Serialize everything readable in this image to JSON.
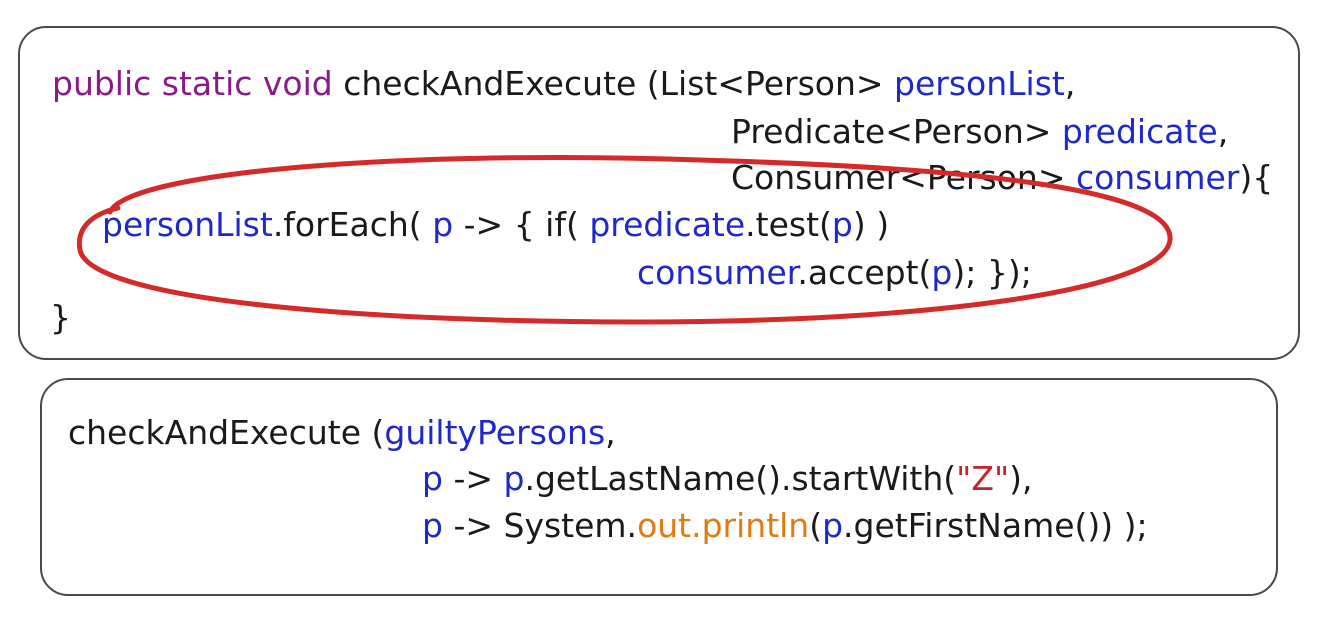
{
  "colors": {
    "keyword": "#8b1a89",
    "variable": "#1f28c8",
    "field": "#e07b12",
    "string": "#c0262b",
    "text": "#1a1a1a",
    "panel_border": "#4a4a4a",
    "highlight": "#d42a2a"
  },
  "method_definition": {
    "line1": {
      "kw_public": "public",
      "kw_static": "static",
      "kw_void": "void",
      "method_name": "checkAndExecute",
      "open_paren_type": "(List<Person>",
      "param1": "personList",
      "comma": ","
    },
    "line2": {
      "type": "Predicate<Person>",
      "param2": "predicate",
      "comma": ","
    },
    "line3": {
      "type": "Consumer<Person>",
      "param3": "consumer",
      "close": "){"
    },
    "line4": {
      "receiver": "personList",
      "call": ".forEach(",
      "lambda_param": "p",
      "arrow_if": "-> { if(",
      "predicate_ref": "predicate",
      "test_call": ".test(",
      "arg": "p",
      "close": ") )"
    },
    "line5": {
      "consumer_ref": "consumer",
      "accept_call": ".accept(",
      "arg": "p",
      "close": "); });"
    },
    "line6": {
      "brace": "}"
    }
  },
  "method_call": {
    "line1": {
      "method_name": "checkAndExecute (",
      "arg1": "guiltyPersons",
      "comma": ","
    },
    "line2": {
      "lambda_param": "p",
      "arrow": "->",
      "receiver": "p",
      "call": ".getLastName().startWith(",
      "string_literal": "\"Z\"",
      "close": "),"
    },
    "line3": {
      "lambda_param": "p",
      "arrow": "-> System.",
      "field": "out.println",
      "open": "(",
      "receiver": "p",
      "call": ".getFirstName()) );"
    }
  }
}
